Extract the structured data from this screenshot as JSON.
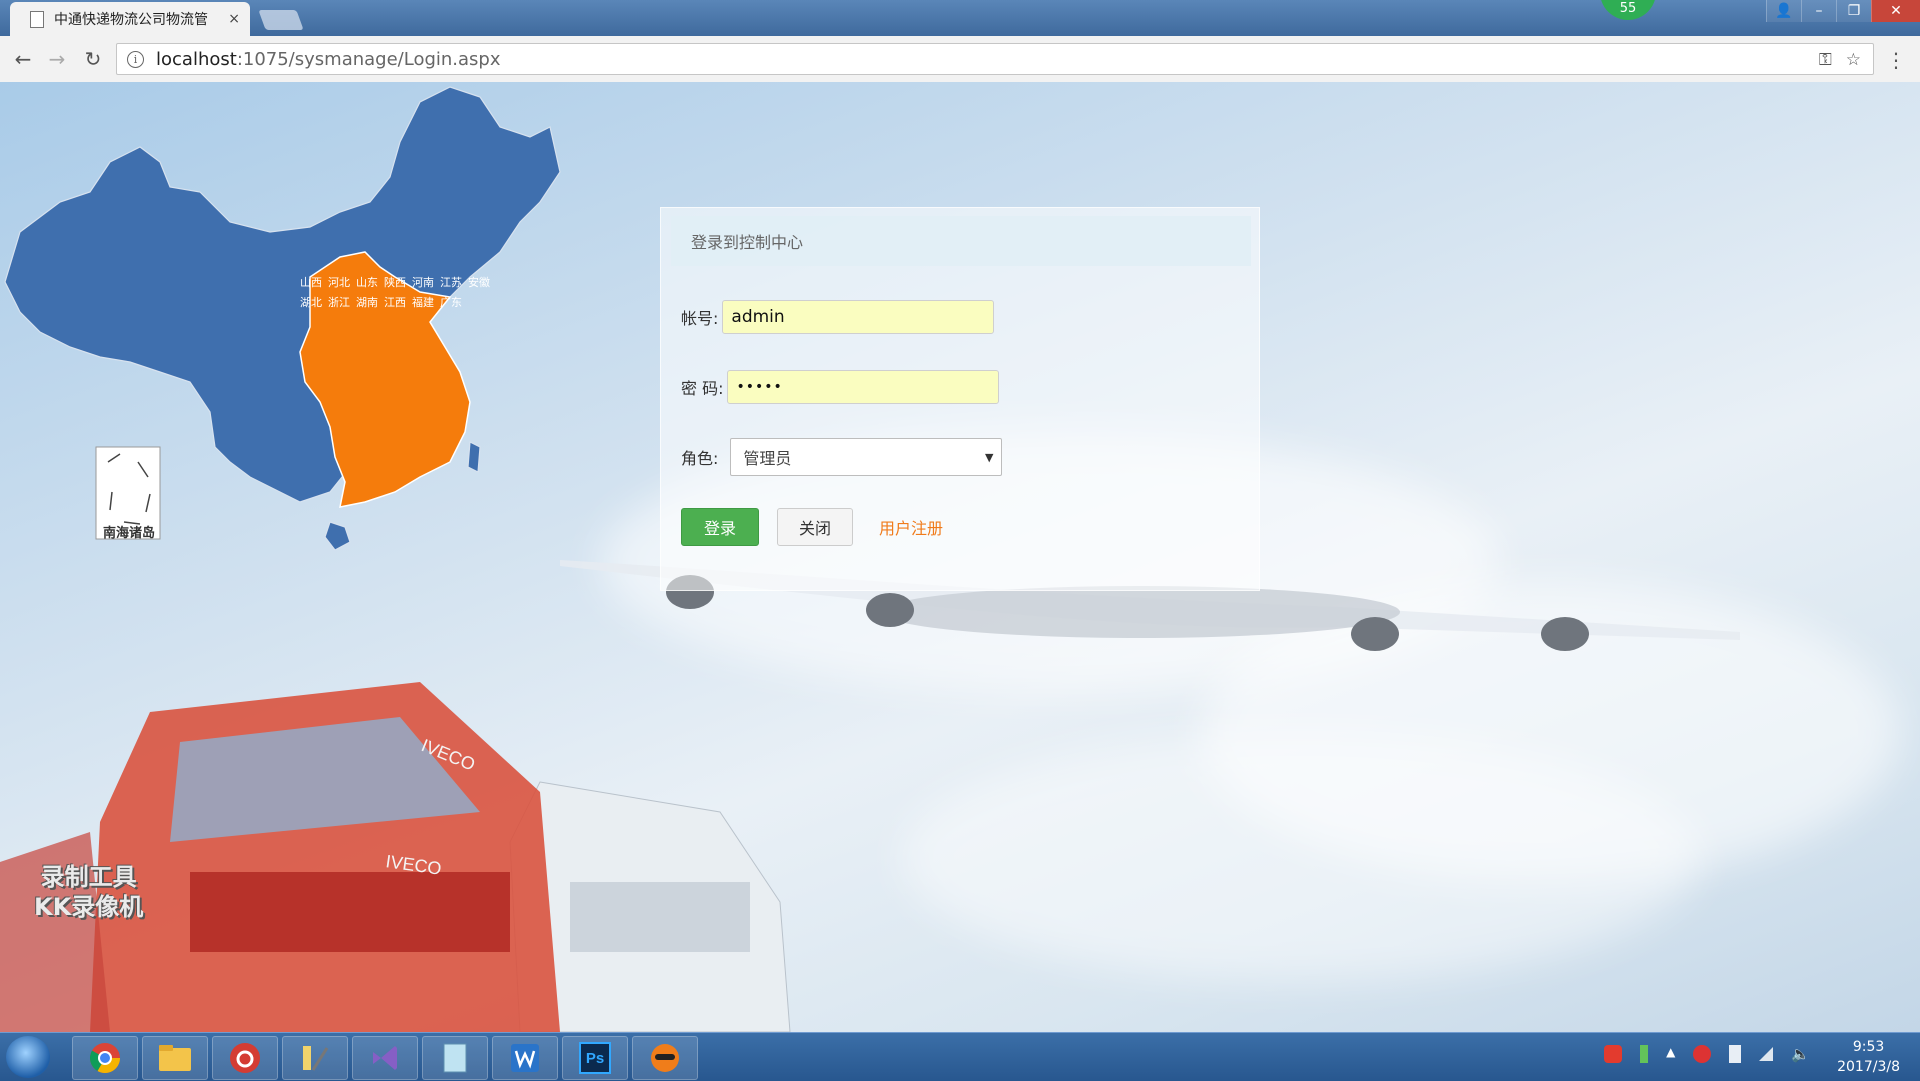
{
  "browser": {
    "tab_title": "中通快递物流公司物流管",
    "tab_close": "×",
    "badge": "55",
    "url_host": "localhost",
    "url_path": ":1075/sysmanage/Login.aspx",
    "nav": {
      "back": "←",
      "forward": "→",
      "reload": "↻"
    }
  },
  "map": {
    "provinces": [
      "山西",
      "河北",
      "山东",
      "陕西",
      "河南",
      "江苏",
      "安徽",
      "湖北",
      "浙江",
      "湖南",
      "江西",
      "福建",
      "广东"
    ],
    "inset_label": "南海诸岛",
    "colors": {
      "highlight": "#f57c0c",
      "base": "#3f6fae"
    }
  },
  "trucks": {
    "brand1": "IVECO",
    "brand2": "IVECO"
  },
  "watermark": {
    "line1": "录制工具",
    "line2": "KK录像机"
  },
  "login": {
    "header": "登录到控制中心",
    "account_label": "帐号:",
    "account_value": "admin",
    "password_label": "密  码:",
    "password_value": "•••••",
    "role_label": "角色:",
    "role_value": "管理员",
    "login_button": "登录",
    "close_button": "关闭",
    "register_link": "用户注册",
    "colors": {
      "login_button": "#4caf50",
      "register_link": "#f07b1b"
    }
  },
  "taskbar": {
    "apps": [
      "chrome-icon",
      "folder-icon",
      "netease-music-icon",
      "tools-icon",
      "visual-studio-icon",
      "notepad-icon",
      "word-icon",
      "photoshop-icon",
      "bandicam-icon"
    ],
    "ps_label": "Ps",
    "time": "9:53",
    "date": "2017/3/8"
  }
}
